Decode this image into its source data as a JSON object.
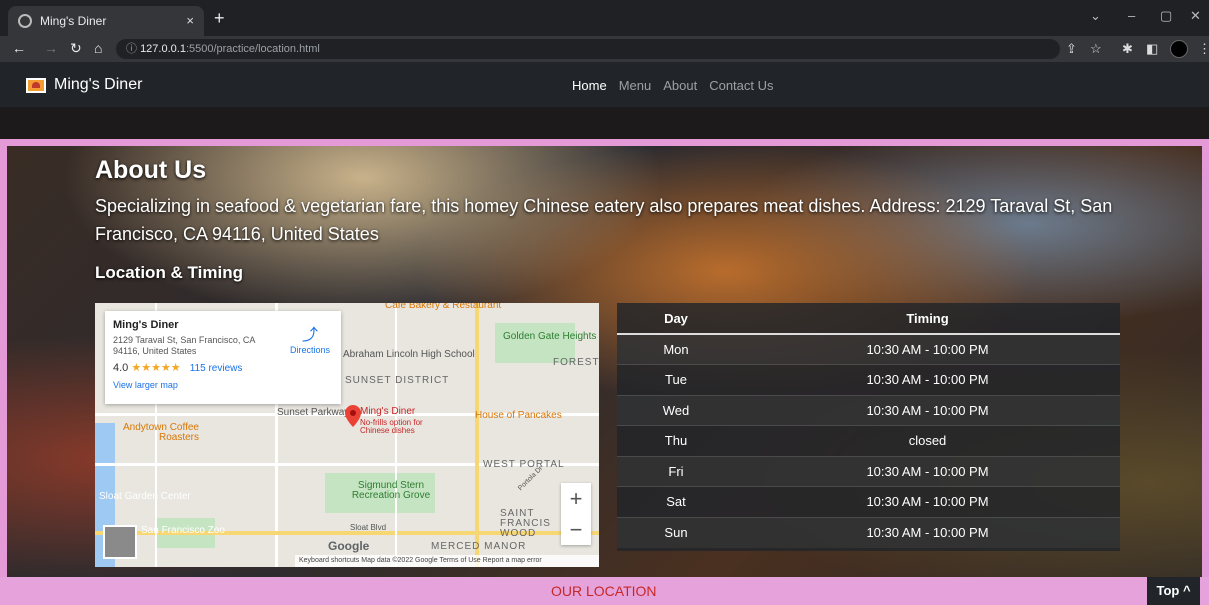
{
  "browser": {
    "tab_title": "Ming's Diner",
    "tab_close": "×",
    "new_tab": "+",
    "url_host": "127.0.0.1",
    "url_path": ":5500/practice/location.html",
    "controls": {
      "minimize": "–",
      "restore": "▢",
      "close": "✕",
      "down": "⌄"
    }
  },
  "site": {
    "brand": "Ming's Diner",
    "nav": [
      {
        "label": "Home",
        "active": true
      },
      {
        "label": "Menu",
        "active": false
      },
      {
        "label": "About",
        "active": false
      },
      {
        "label": "Contact Us",
        "active": false
      }
    ]
  },
  "about": {
    "heading": "About Us",
    "description": "Specializing in seafood & vegetarian fare, this homey Chinese eatery also prepares meat dishes. Address: 2129 Taraval St, San Francisco, CA 94116, United States",
    "location_heading": "Location & Timing"
  },
  "map": {
    "card_name": "Ming's Diner",
    "card_address": "2129 Taraval St, San Francisco, CA 94116, United States",
    "rating": "4.0",
    "stars": "★★★★★",
    "reviews": "115 reviews",
    "larger_map": "View larger map",
    "directions": "Directions",
    "labels": {
      "cafe": "Cafe Bakery & Restaurant",
      "golden_gate": "Golden Gate Heights Park",
      "forest": "FOREST",
      "lincoln": "Abraham Lincoln High School",
      "sunset": "SUNSET DISTRICT",
      "parkway": "Sunset Parkway",
      "pin_name": "Ming's Diner",
      "pin_sub": "No-frills option for Chinese dishes",
      "pancakes": "House of Pancakes",
      "andytown": "Andytown Coffee Roasters",
      "west_portal": "WEST PORTAL",
      "stern": "Sigmund Stern Recreation Grove",
      "sloat_garden": "Sloat Garden Center",
      "saint_francis": "SAINT FRANCIS WOOD",
      "zoo": "San Francisco Zoo",
      "sloat_blvd": "Sloat Blvd",
      "merced": "MERCED MANOR",
      "portola": "Portola Dr"
    },
    "google": "Google",
    "attribution": "Keyboard shortcuts   Map data ©2022 Google   Terms of Use   Report a map error",
    "zoom_in": "+",
    "zoom_out": "−"
  },
  "timing": {
    "headers": [
      "Day",
      "Timing"
    ],
    "rows": [
      [
        "Mon",
        "10:30 AM - 10:00 PM"
      ],
      [
        "Tue",
        "10:30 AM - 10:00 PM"
      ],
      [
        "Wed",
        "10:30 AM - 10:00 PM"
      ],
      [
        "Thu",
        "closed"
      ],
      [
        "Fri",
        "10:30 AM - 10:00 PM"
      ],
      [
        "Sat",
        "10:30 AM - 10:00 PM"
      ],
      [
        "Sun",
        "10:30 AM - 10:00 PM"
      ]
    ]
  },
  "footer": {
    "our_location": "OUR LOCATION",
    "top_button": "Top ^"
  },
  "colors": {
    "pink": "#e39ad6",
    "dark": "#212529",
    "red_text": "#c62828"
  }
}
